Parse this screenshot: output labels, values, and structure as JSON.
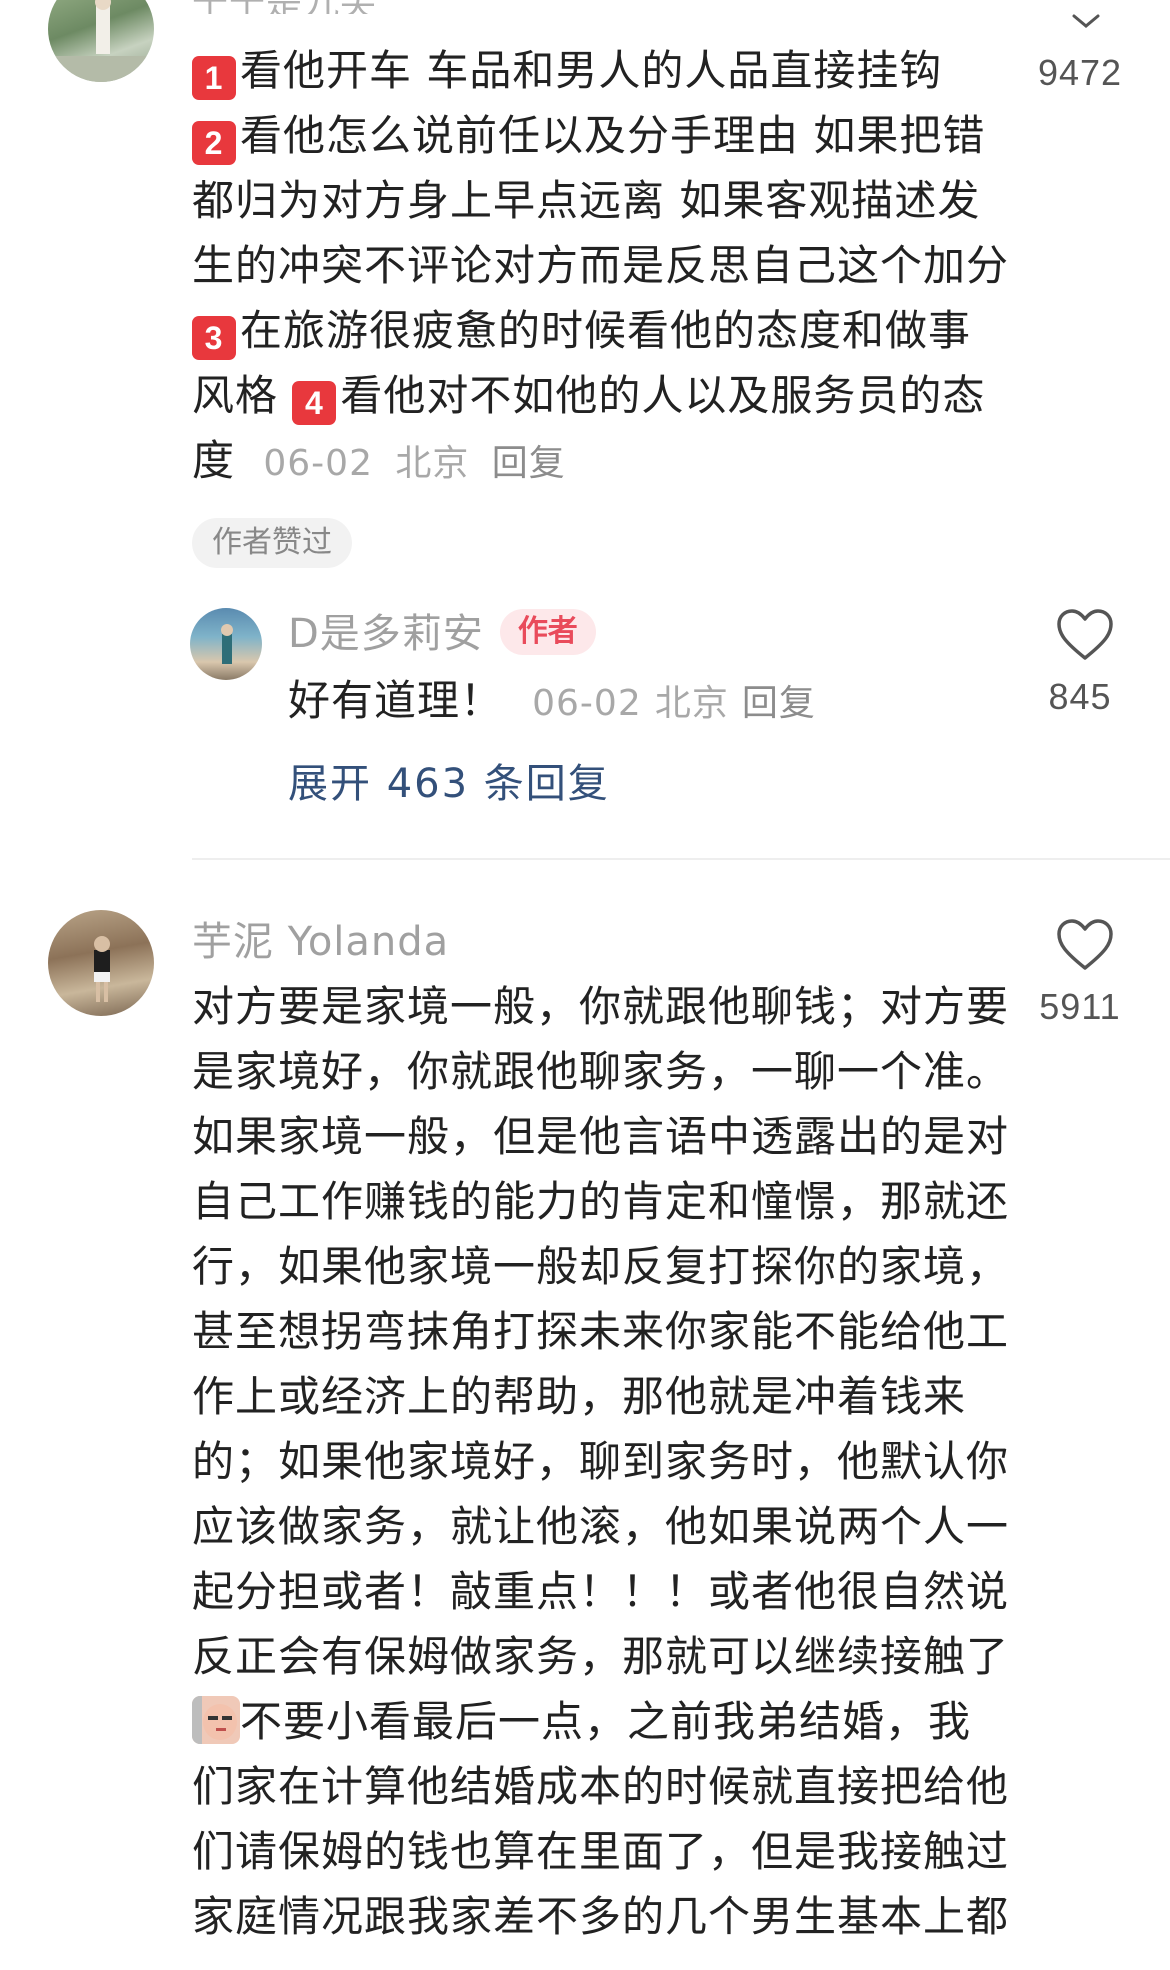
{
  "comment1": {
    "username_partial": "千千是九尖",
    "likes": "9472",
    "lines": [
      [
        "badge:1",
        "看他开车 车品和男人的人品直接挂钩"
      ],
      [
        "badge:2",
        "看他怎么说前任以及分手理由 如果把错"
      ],
      [
        "",
        "都归为对方身上早点远离 如果客观描述发"
      ],
      [
        "",
        "生的冲突不评论对方而是反思自己这个加分"
      ],
      [
        "badge:3",
        "在旅游很疲惫的时候看他的态度和做事"
      ],
      [
        "",
        "风格 "
      ]
    ],
    "line6_badge": "4",
    "line6_rest": "看他对不如他的人以及服务员的态",
    "last_line": "度",
    "date": "06-02",
    "location": "北京",
    "reply": "回复",
    "author_liked": "作者赞过"
  },
  "reply1": {
    "username": "D是多莉安",
    "tag": "作者",
    "text": "好有道理！",
    "date": "06-02",
    "location": "北京",
    "reply": "回复",
    "likes": "845"
  },
  "expand_label": "展开 463 条回复",
  "comment2": {
    "username": "芋泥 Yolanda",
    "likes": "5911",
    "lines": [
      "对方要是家境一般，你就跟他聊钱；对方要",
      "是家境好，你就跟他聊家务，一聊一个准。",
      "如果家境一般，但是他言语中透露出的是对",
      "自己工作赚钱的能力的肯定和憧憬，那就还",
      "行，如果他家境一般却反复打探你的家境，",
      "甚至想拐弯抹角打探未来你家能不能给他工",
      "作上或经济上的帮助，那他就是冲着钱来",
      "的；如果他家境好，聊到家务时，他默认你",
      "应该做家务，就让他滚，他如果说两个人一",
      "起分担或者！敲重点！！！或者他很自然说",
      "反正会有保姆做家务，那就可以继续接触了",
      "不要小看最后一点，之前我弟结婚，我",
      "们家在计算他结婚成本的时候就直接把给他",
      "们请保姆的钱也算在里面了，但是我接触过",
      "家庭情况跟我家差不多的几个男生基本上都"
    ]
  },
  "colors": {
    "badge_red": "#e8383d",
    "link_blue": "#33507a",
    "author_tag_bg": "#fde8ea",
    "author_tag_fg": "#e94b5b"
  }
}
